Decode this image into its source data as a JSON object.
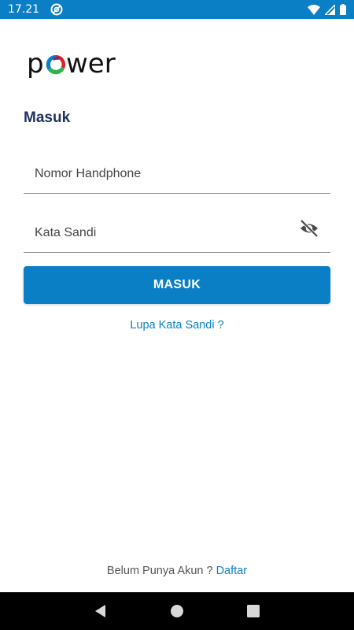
{
  "status_bar": {
    "time": "17.21",
    "icons": [
      "sync-icon",
      "wifi-icon",
      "signal-icon",
      "battery-icon"
    ]
  },
  "logo": {
    "text": "power",
    "colors": [
      "#e31e24",
      "#0b7fc6",
      "#2eb34a",
      "#6a2c8f"
    ]
  },
  "login": {
    "title": "Masuk",
    "phone_label": "Nomor Handphone",
    "password_label": "Kata Sandi",
    "submit_label": "MASUK",
    "forgot_label": "Lupa Kata Sandi ?"
  },
  "footer": {
    "prompt": "Belum Punya Akun ?",
    "register_label": "Daftar"
  },
  "nav": {
    "buttons": [
      "back-icon",
      "home-icon",
      "recents-icon"
    ]
  },
  "colors": {
    "primary": "#0b7fc6",
    "title": "#1d3461"
  }
}
